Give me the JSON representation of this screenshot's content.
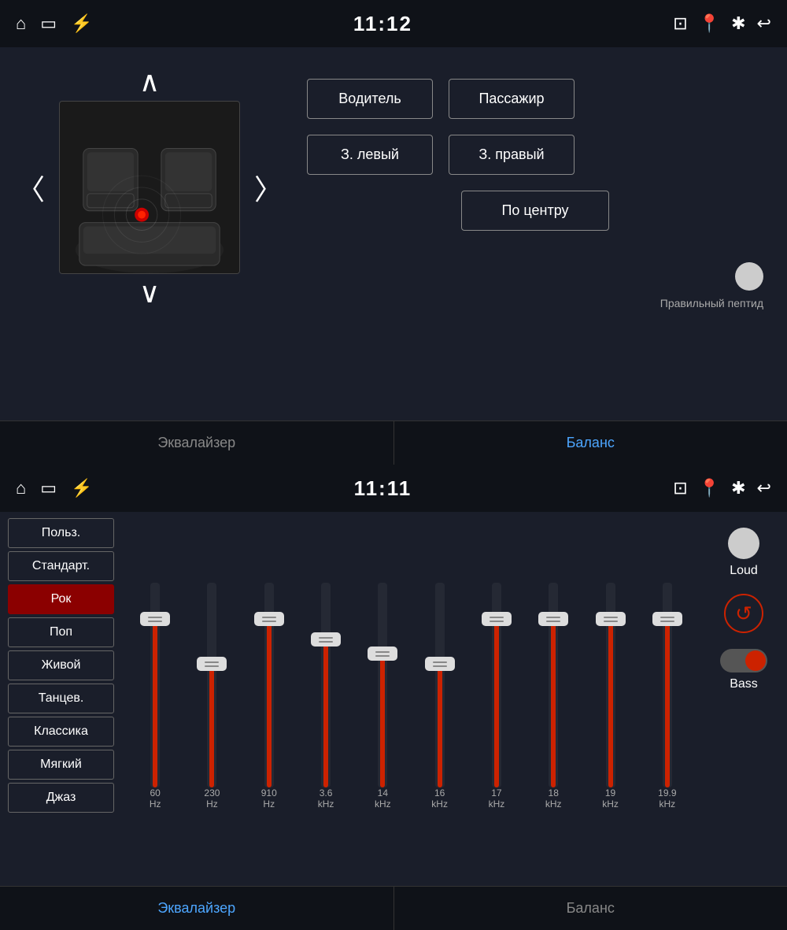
{
  "top": {
    "status_bar": {
      "time": "11:12",
      "left_icons": [
        "home",
        "screen",
        "usb"
      ],
      "right_icons": [
        "cast",
        "location",
        "bluetooth",
        "back"
      ]
    },
    "seat_buttons": {
      "btn_driver": "Водитель",
      "btn_passenger": "Пассажир",
      "btn_rear_left": "З. левый",
      "btn_rear_right": "З. правый",
      "btn_center": "По центру",
      "toggle_label": "Правильный пептид"
    },
    "tabs": [
      {
        "label": "Эквалайзер",
        "active": false
      },
      {
        "label": "Баланс",
        "active": true
      }
    ]
  },
  "bottom": {
    "status_bar": {
      "time": "11:11",
      "left_icons": [
        "home",
        "screen",
        "usb"
      ],
      "right_icons": [
        "cast",
        "location",
        "bluetooth",
        "back"
      ]
    },
    "presets": [
      {
        "label": "Польз.",
        "active": false
      },
      {
        "label": "Стандарт.",
        "active": false
      },
      {
        "label": "Рок",
        "active": true
      },
      {
        "label": "Поп",
        "active": false
      },
      {
        "label": "Живой",
        "active": false
      },
      {
        "label": "Танцев.",
        "active": false
      },
      {
        "label": "Классика",
        "active": false
      },
      {
        "label": "Мягкий",
        "active": false
      },
      {
        "label": "Джаз",
        "active": false
      }
    ],
    "sliders": [
      {
        "freq": "60",
        "unit": "Hz",
        "height_pct": 82
      },
      {
        "freq": "230",
        "unit": "Hz",
        "height_pct": 60
      },
      {
        "freq": "910",
        "unit": "Hz",
        "height_pct": 82
      },
      {
        "freq": "3.6",
        "unit": "kHz",
        "height_pct": 72
      },
      {
        "freq": "14",
        "unit": "kHz",
        "height_pct": 65
      },
      {
        "freq": "16",
        "unit": "kHz",
        "height_pct": 60
      },
      {
        "freq": "17",
        "unit": "kHz",
        "height_pct": 82
      },
      {
        "freq": "18",
        "unit": "kHz",
        "height_pct": 82
      },
      {
        "freq": "19",
        "unit": "kHz",
        "height_pct": 82
      },
      {
        "freq": "19.9",
        "unit": "kHz",
        "height_pct": 82
      }
    ],
    "controls": {
      "loud_label": "Loud",
      "reset_symbol": "↺",
      "bass_label": "Bass"
    },
    "tabs": [
      {
        "label": "Эквалайзер",
        "active": true
      },
      {
        "label": "Баланс",
        "active": false
      }
    ]
  }
}
